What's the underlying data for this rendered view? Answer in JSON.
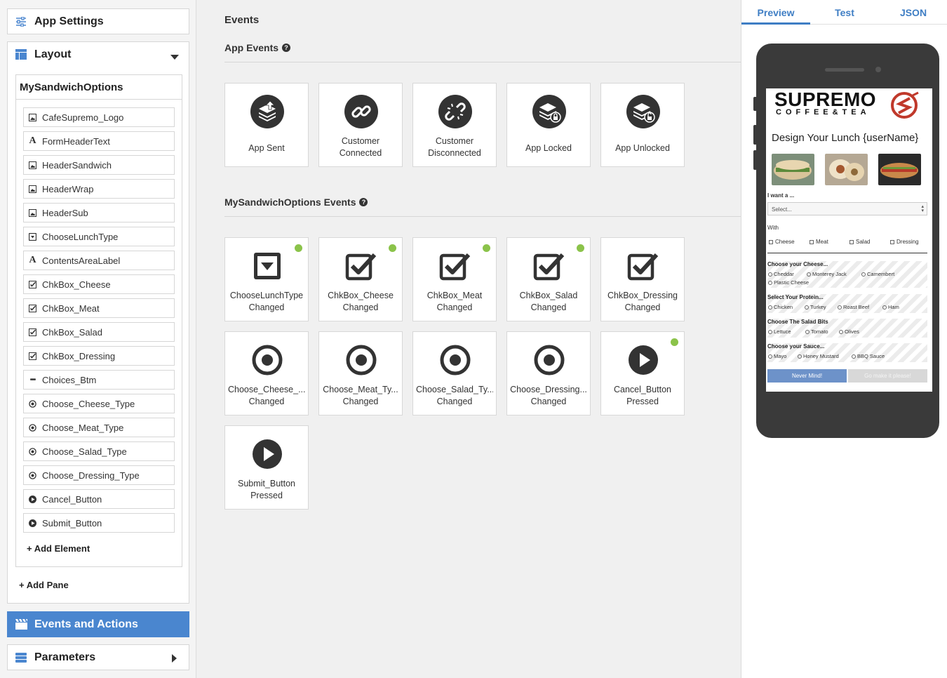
{
  "sidebar": {
    "app_settings": "App Settings",
    "layout": "Layout",
    "pane_name": "MySandwichOptions",
    "elements": [
      {
        "label": "CafeSupremo_Logo",
        "icon": "image-icon"
      },
      {
        "label": "FormHeaderText",
        "icon": "text-icon"
      },
      {
        "label": "HeaderSandwich",
        "icon": "image-icon"
      },
      {
        "label": "HeaderWrap",
        "icon": "image-icon"
      },
      {
        "label": "HeaderSub",
        "icon": "image-icon"
      },
      {
        "label": "ChooseLunchType",
        "icon": "dropdown-icon"
      },
      {
        "label": "ContentsAreaLabel",
        "icon": "text-icon"
      },
      {
        "label": "ChkBox_Cheese",
        "icon": "checkbox-icon"
      },
      {
        "label": "ChkBox_Meat",
        "icon": "checkbox-icon"
      },
      {
        "label": "ChkBox_Salad",
        "icon": "checkbox-icon"
      },
      {
        "label": "ChkBox_Dressing",
        "icon": "checkbox-icon"
      },
      {
        "label": "Choices_Btm",
        "icon": "ellipsis-icon"
      },
      {
        "label": "Choose_Cheese_Type",
        "icon": "radio-icon"
      },
      {
        "label": "Choose_Meat_Type",
        "icon": "radio-icon"
      },
      {
        "label": "Choose_Salad_Type",
        "icon": "radio-icon"
      },
      {
        "label": "Choose_Dressing_Type",
        "icon": "radio-icon"
      },
      {
        "label": "Cancel_Button",
        "icon": "play-icon"
      },
      {
        "label": "Submit_Button",
        "icon": "play-icon"
      }
    ],
    "add_element": "+ Add Element",
    "add_pane": "+ Add Pane",
    "events_actions": "Events and Actions",
    "parameters": "Parameters"
  },
  "main": {
    "title": "Events",
    "app_events_title": "App Events",
    "app_events": [
      {
        "label": "App Sent",
        "icon": "app-sent-icon",
        "dot": false
      },
      {
        "label": "Customer\nConnected",
        "icon": "link-icon",
        "dot": false
      },
      {
        "label": "Customer\nDisconnected",
        "icon": "broken-link-icon",
        "dot": false
      },
      {
        "label": "App Locked",
        "icon": "app-locked-icon",
        "dot": false
      },
      {
        "label": "App Unlocked",
        "icon": "app-unlocked-icon",
        "dot": false
      }
    ],
    "pane_events_title": "MySandwichOptions Events",
    "pane_events": [
      {
        "label": "ChooseLunchType\nChanged",
        "icon": "dropdown-icon",
        "dot": true
      },
      {
        "label": "ChkBox_Cheese\nChanged",
        "icon": "checkbox-icon",
        "dot": true
      },
      {
        "label": "ChkBox_Meat\nChanged",
        "icon": "checkbox-icon",
        "dot": true
      },
      {
        "label": "ChkBox_Salad\nChanged",
        "icon": "checkbox-icon",
        "dot": true
      },
      {
        "label": "ChkBox_Dressing\nChanged",
        "icon": "checkbox-icon",
        "dot": false
      },
      {
        "label": "Choose_Cheese_...\nChanged",
        "icon": "radio-icon",
        "dot": false
      },
      {
        "label": "Choose_Meat_Ty...\nChanged",
        "icon": "radio-icon",
        "dot": false
      },
      {
        "label": "Choose_Salad_Ty...\nChanged",
        "icon": "radio-icon",
        "dot": false
      },
      {
        "label": "Choose_Dressing...\nChanged",
        "icon": "radio-icon",
        "dot": false
      },
      {
        "label": "Cancel_Button\nPressed",
        "icon": "play-icon",
        "dot": true
      },
      {
        "label": "Submit_Button\nPressed",
        "icon": "play-icon",
        "dot": false
      }
    ]
  },
  "preview": {
    "tabs": [
      "Preview",
      "Test",
      "JSON"
    ],
    "active_tab": "Preview",
    "logo_word": "SUPREMO",
    "logo_sub": "COFFEE&TEA",
    "title": "Design Your Lunch {userName}",
    "want_label": "I want a ...",
    "select_placeholder": "Select...",
    "with_label": "With",
    "checkboxes": [
      "Cheese",
      "Meat",
      "Salad",
      "Dressing"
    ],
    "groups": [
      {
        "title": "Choose your Cheese...",
        "options": [
          "Cheddar",
          "Monterey Jack",
          "Camembert",
          "Plastic Cheese"
        ]
      },
      {
        "title": "Select Your Protein...",
        "options": [
          "Chicken",
          "Turkey",
          "Roast Beef",
          "Ham"
        ]
      },
      {
        "title": "Choose The Salad Bits",
        "options": [
          "Lettuce",
          "Tomato",
          "Olives"
        ]
      },
      {
        "title": "Choose your Sauce...",
        "options": [
          "Mayo",
          "Honey Mustard",
          "BBQ Sauce"
        ]
      }
    ],
    "cancel_label": "Never Mind!",
    "submit_label": "Go make it please!"
  },
  "colors": {
    "accent": "#4a86cf",
    "tab_blue": "#3f7ec4",
    "dot_green": "#8bc34a",
    "logo_red": "#c0392b"
  }
}
